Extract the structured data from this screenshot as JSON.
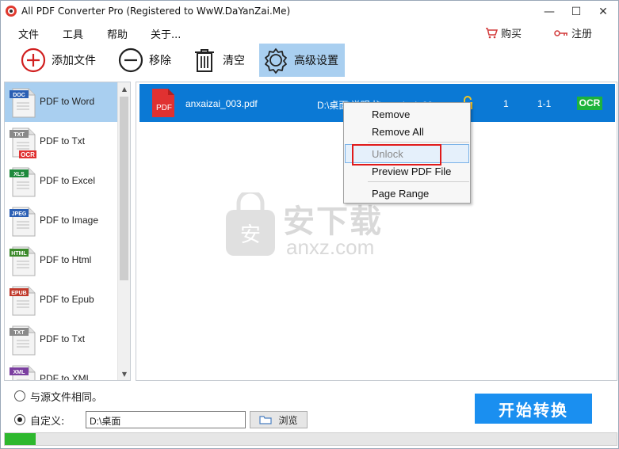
{
  "window": {
    "title": "All PDF Converter Pro (Registered to WwW.DaYanZai.Me)",
    "controls": {
      "minimize": "—",
      "maximize": "☐",
      "close": "✕"
    }
  },
  "menu": {
    "items": [
      "文件",
      "工具",
      "帮助",
      "关于..."
    ],
    "buy_label": "购买",
    "register_label": "注册"
  },
  "toolbar": {
    "add_label": "添加文件",
    "remove_label": "移除",
    "clear_label": "清空",
    "settings_label": "高级设置"
  },
  "converters": [
    {
      "tag": "DOC",
      "label": "PDF to Word",
      "tag_color": "#2b5fb4",
      "selected": true
    },
    {
      "tag": "TXT",
      "label": "PDF to Txt",
      "tag_color": "#8a8a8a",
      "ocr": "OCR"
    },
    {
      "tag": "XLS",
      "label": "PDF to Excel",
      "tag_color": "#1e8a3c"
    },
    {
      "tag": "JPEG",
      "label": "PDF to Image",
      "tag_color": "#2b5fb4"
    },
    {
      "tag": "HTML",
      "label": "PDF to Html",
      "tag_color": "#3b8a2b"
    },
    {
      "tag": "EPUB",
      "label": "PDF to Epub",
      "tag_color": "#c0392b"
    },
    {
      "tag": "TXT",
      "label": "PDF to Txt",
      "tag_color": "#8a8a8a"
    },
    {
      "tag": "XML",
      "label": "PDF to XML",
      "tag_color": "#7b3fa0"
    }
  ],
  "file_row": {
    "icon_label": "PDF",
    "name": "anxaizai_003.pdf",
    "path": "D:\\桌面\\说明书\\anxaizai_00",
    "pages": "1",
    "range": "1-1",
    "ocr": "OCR"
  },
  "context_menu": {
    "items": [
      "Remove",
      "Remove All",
      "Unlock",
      "Preview PDF File",
      "Page Range"
    ]
  },
  "watermark": {
    "cn": "安下载",
    "en": "anxz.com"
  },
  "output": {
    "same_as_source_label": "与源文件相同。",
    "custom_label": "自定义:",
    "custom_path": "D:\\桌面",
    "browse_label": "浏览",
    "selected": "custom"
  },
  "start_button_label": "开始转换",
  "progress_fraction": 0.05,
  "colors": {
    "accent": "#0b79d5",
    "start_button": "#1a8ff0",
    "progress": "#2eb82e",
    "ocr_badge": "#1db33b",
    "highlight_box": "#e01a1a"
  }
}
